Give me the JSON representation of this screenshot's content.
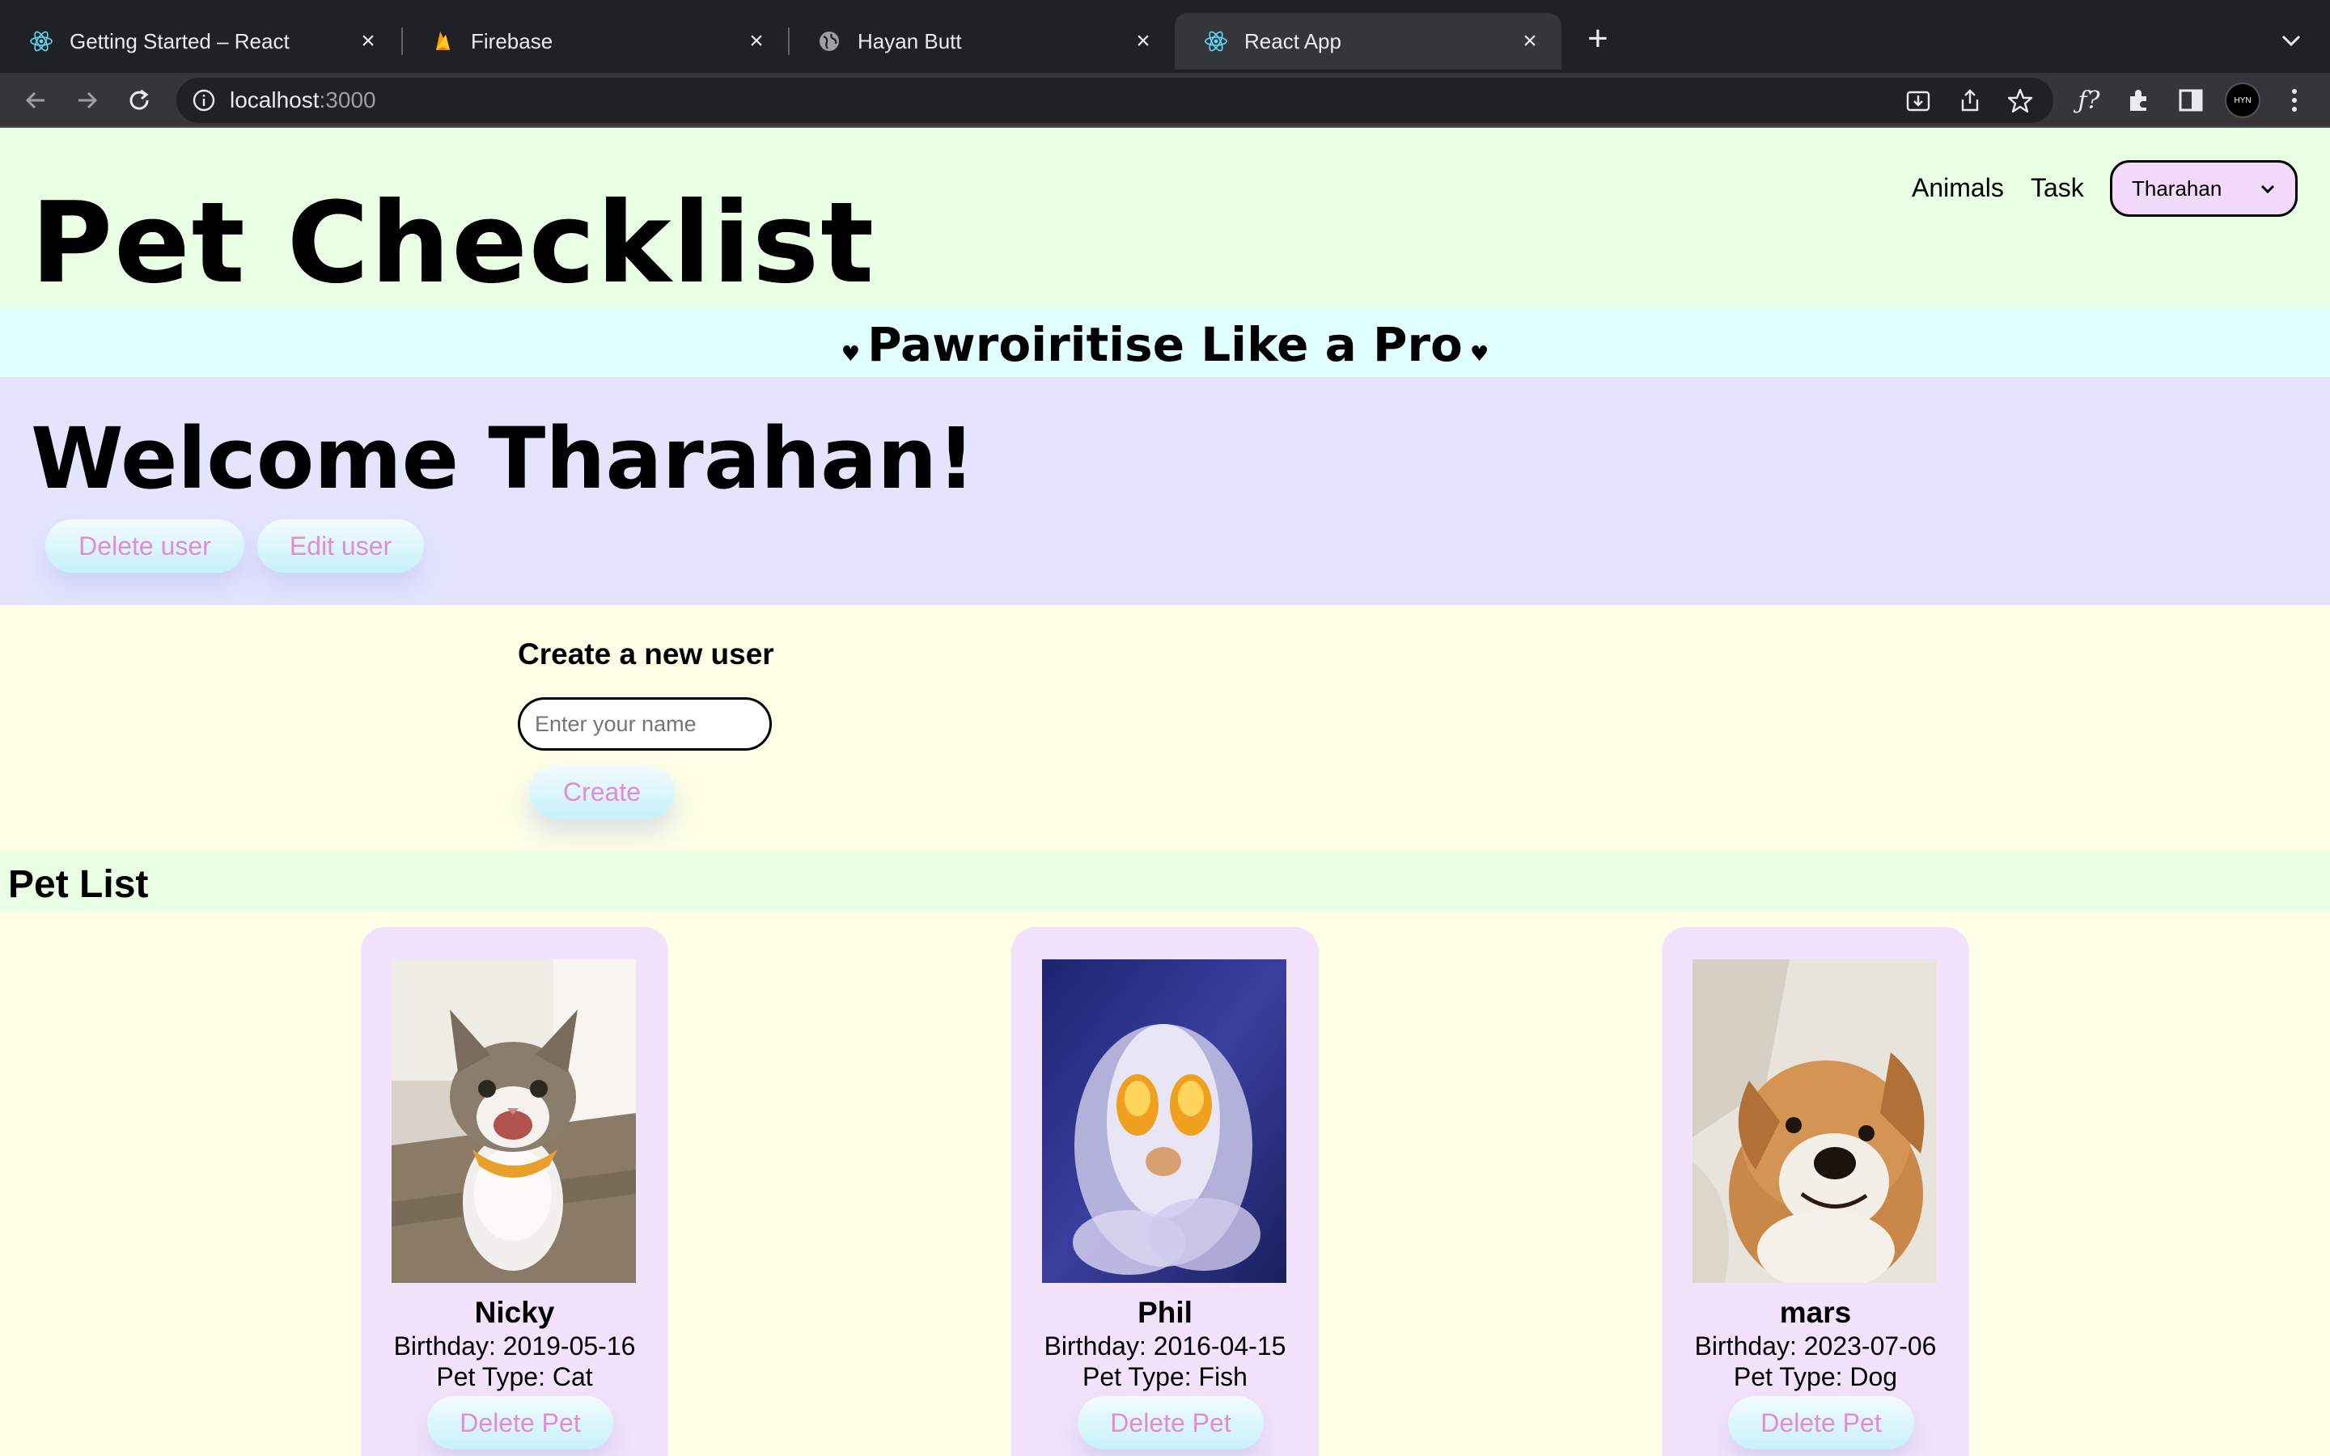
{
  "browser": {
    "tabs": [
      {
        "title": "Getting Started – React",
        "icon": "react-icon"
      },
      {
        "title": "Firebase",
        "icon": "firebase-icon"
      },
      {
        "title": "Hayan Butt",
        "icon": "globe-icon"
      },
      {
        "title": "React App",
        "icon": "react-icon",
        "active": true
      }
    ],
    "url_host": "localhost",
    "url_port": ":3000",
    "profile_initials": "HYN"
  },
  "header": {
    "title": "Pet Checklist",
    "nav": {
      "animals": "Animals",
      "task": "Task"
    },
    "user_select": {
      "value": "Tharahan"
    }
  },
  "tagline": "Pawroiritise Like a Pro",
  "welcome": {
    "text": "Welcome Tharahan!",
    "delete_user": "Delete user",
    "edit_user": "Edit user"
  },
  "create_user": {
    "title": "Create a new user",
    "placeholder": "Enter your name",
    "button": "Create"
  },
  "pet_list": {
    "title": "Pet List",
    "pets": [
      {
        "name": "Nicky",
        "birthday": "Birthday: 2019-05-16",
        "type": "Pet Type: Cat",
        "delete": "Delete Pet"
      },
      {
        "name": "Phil",
        "birthday": "Birthday: 2016-04-15",
        "type": "Pet Type: Fish",
        "delete": "Delete Pet"
      },
      {
        "name": "mars",
        "birthday": "Birthday: 2023-07-06",
        "type": "Pet Type: Dog",
        "delete": "Delete Pet"
      }
    ]
  },
  "colors": {
    "header_bg": "#e8ffe4",
    "tagline_bg": "#e2ffff",
    "welcome_bg": "#e4e4ff",
    "page_bg": "#fdffe6",
    "card_bg": "#f3e2fb",
    "button_text": "#e58ad8"
  }
}
